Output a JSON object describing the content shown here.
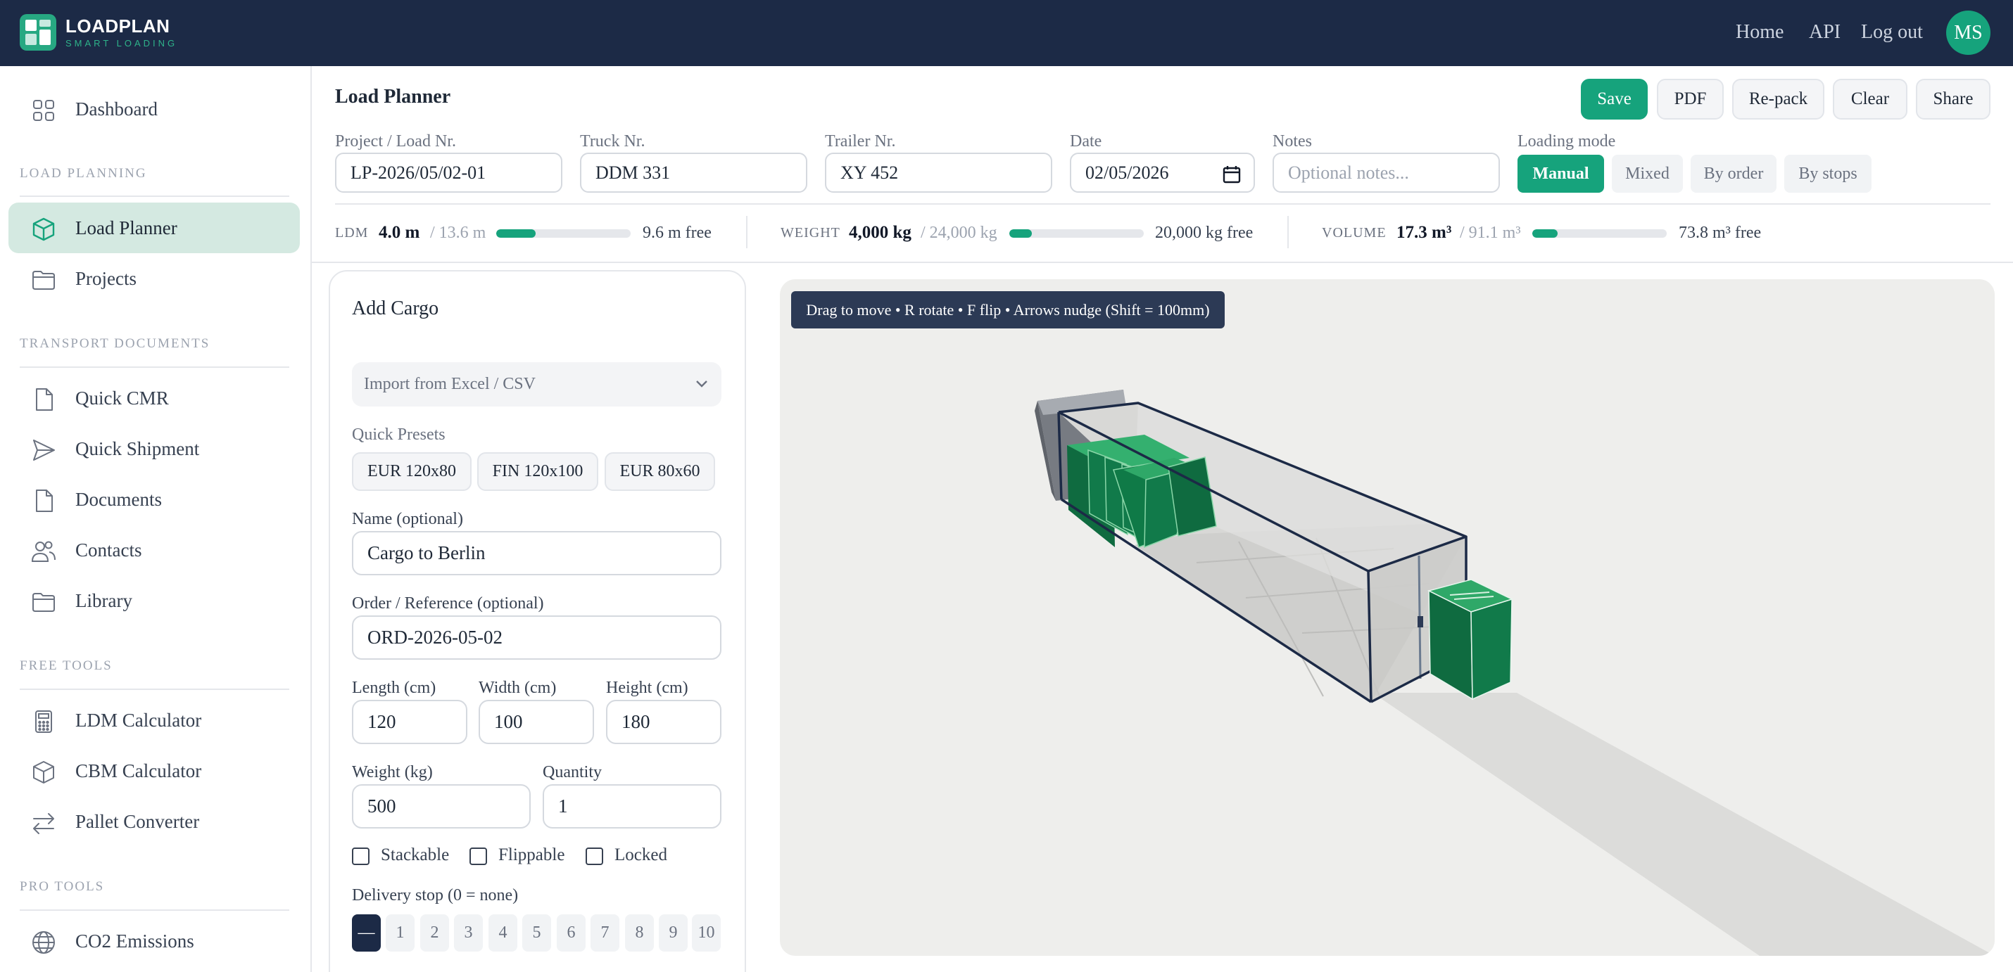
{
  "app": {
    "brand": "LOADPLAN",
    "tagline": "SMART LOADING",
    "nav": [
      "Home",
      "API",
      "Log out"
    ],
    "user_initials": "MS"
  },
  "sidebar": {
    "items": [
      {
        "label": "Dashboard",
        "icon": "grid-icon"
      },
      {
        "label": "Load Planner",
        "icon": "cube-icon",
        "active": true
      },
      {
        "label": "Projects",
        "icon": "folder-icon"
      },
      {
        "label": "Quick CMR",
        "icon": "file-icon"
      },
      {
        "label": "Quick Shipment",
        "icon": "send-icon"
      },
      {
        "label": "Documents",
        "icon": "file-icon"
      },
      {
        "label": "Contacts",
        "icon": "users-icon"
      },
      {
        "label": "Library",
        "icon": "folder-icon"
      },
      {
        "label": "LDM Calculator",
        "icon": "calculator-icon"
      },
      {
        "label": "CBM Calculator",
        "icon": "cube-icon"
      },
      {
        "label": "Pallet Converter",
        "icon": "arrows-swap-icon"
      },
      {
        "label": "CO2 Emissions",
        "icon": "globe-icon"
      }
    ],
    "sections": [
      "LOAD PLANNING",
      "TRANSPORT DOCUMENTS",
      "FREE TOOLS",
      "PRO TOOLS"
    ]
  },
  "header": {
    "title": "Load Planner",
    "actions": [
      "Save",
      "PDF",
      "Re-pack",
      "Clear",
      "Share"
    ]
  },
  "form": {
    "project_label": "Project / Load Nr.",
    "project_value": "LP-2026/05/02-01",
    "truck_label": "Truck Nr.",
    "truck_value": "DDM 331",
    "trailer_label": "Trailer Nr.",
    "trailer_value": "XY 452",
    "date_label": "Date",
    "date_value": "02/05/2026",
    "notes_label": "Notes",
    "notes_placeholder": "Optional notes...",
    "mode_label": "Loading mode",
    "modes": [
      "Manual",
      "Mixed",
      "By order",
      "By stops"
    ],
    "active_mode": "Manual"
  },
  "stats": {
    "ldm": {
      "key": "LDM",
      "value": "4.0 m",
      "total": "/ 13.6 m",
      "free": "9.6 m free",
      "fill": 0.294
    },
    "weight": {
      "key": "WEIGHT",
      "value": "4,000 kg",
      "total": "/ 24,000 kg",
      "free": "20,000 kg free",
      "fill": 0.167
    },
    "volume": {
      "key": "VOLUME",
      "value": "17.3 m³",
      "total": "/ 91.1 m³",
      "free": "73.8 m³ free",
      "fill": 0.19
    }
  },
  "cargo": {
    "title": "Add Cargo",
    "import_label": "Import from Excel / CSV",
    "presets_label": "Quick Presets",
    "presets": [
      "EUR 120x80",
      "FIN 120x100",
      "EUR 80x60"
    ],
    "name_label": "Name (optional)",
    "name_value": "Cargo to Berlin",
    "order_label": "Order / Reference (optional)",
    "order_value": "ORD-2026-05-02",
    "length_label": "Length (cm)",
    "length_value": "120",
    "width_label": "Width (cm)",
    "width_value": "100",
    "height_label": "Height (cm)",
    "height_value": "180",
    "weight_label": "Weight (kg)",
    "weight_value": "500",
    "qty_label": "Quantity",
    "qty_value": "1",
    "checks": [
      "Stackable",
      "Flippable",
      "Locked"
    ],
    "stop_label": "Delivery stop (0 = none)",
    "stops": [
      "—",
      "1",
      "2",
      "3",
      "4",
      "5",
      "6",
      "7",
      "8",
      "9",
      "10"
    ]
  },
  "viewer": {
    "hint": "Drag to move • R rotate • F flip • Arrows nudge (Shift = 100mm)"
  },
  "colors": {
    "accent": "#16a37c",
    "topbar": "#1c2a46",
    "cargo_box": "#117a4a",
    "container_edge": "#1c2a46"
  }
}
